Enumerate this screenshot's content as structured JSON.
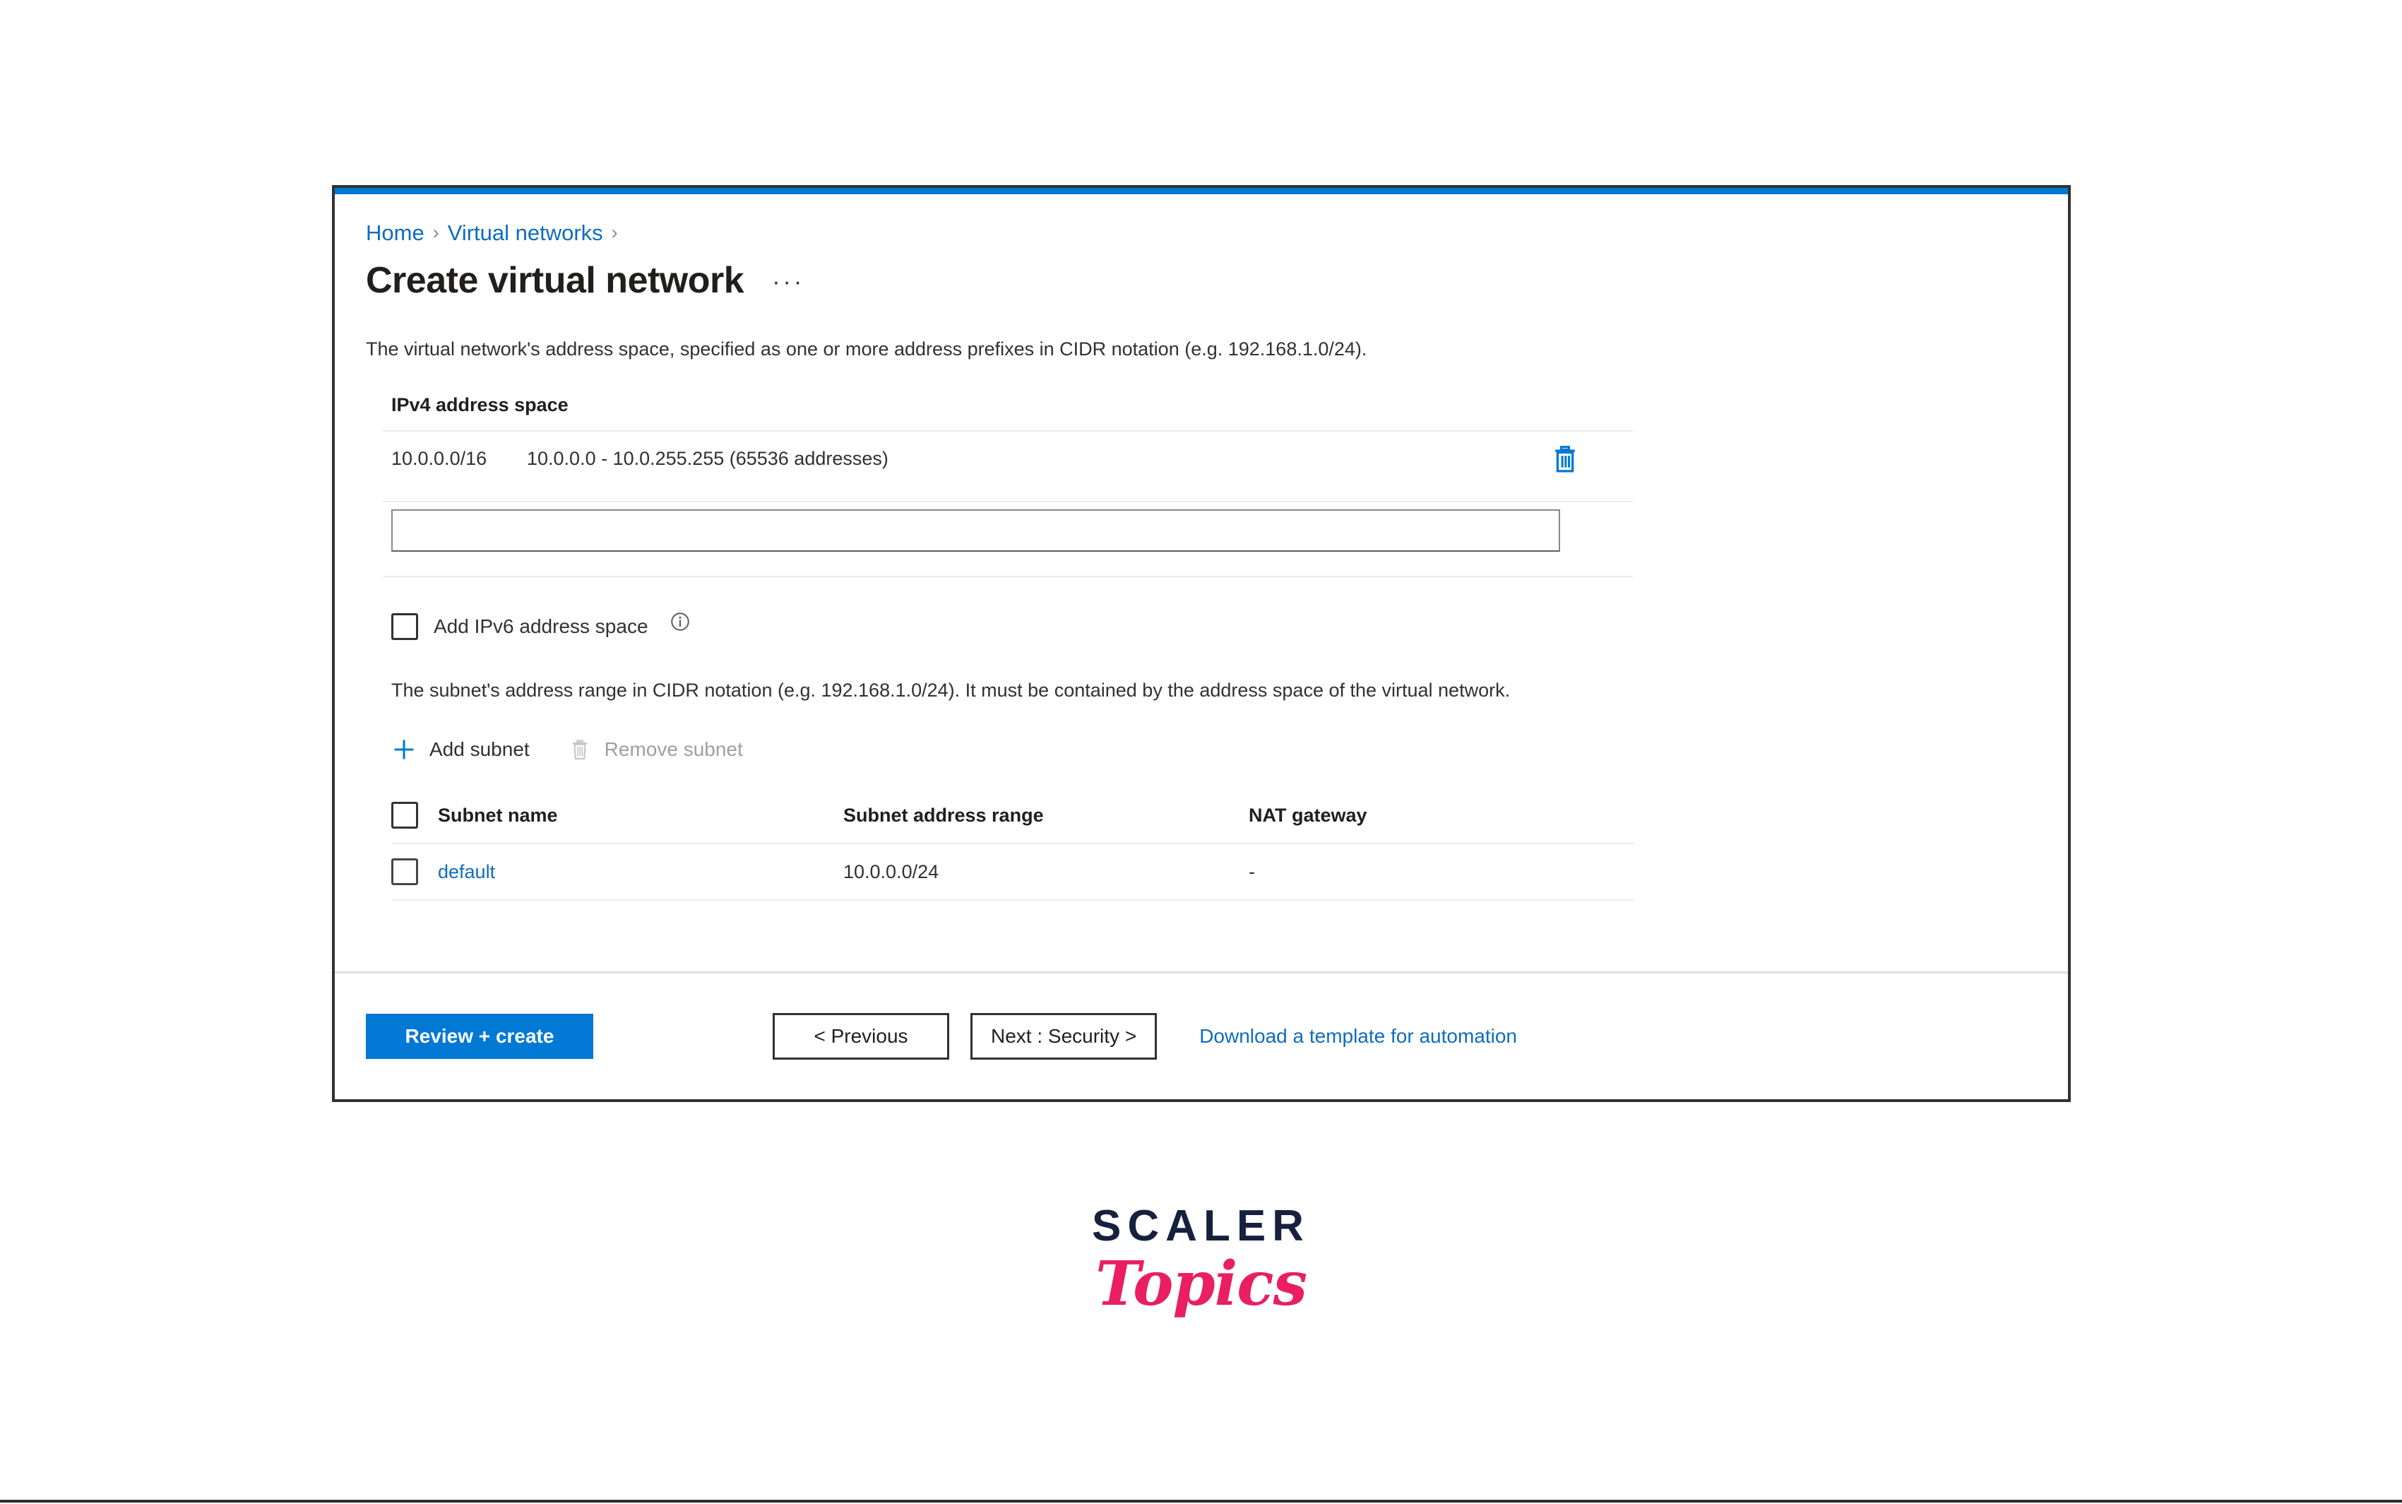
{
  "breadcrumb": {
    "items": [
      {
        "label": "Home"
      },
      {
        "label": "Virtual networks"
      }
    ],
    "separator": "›"
  },
  "header": {
    "title": "Create virtual network",
    "more_actions": "···"
  },
  "address_space": {
    "helper_text": "The virtual network's address space, specified as one or more address prefixes in CIDR notation (e.g. 192.168.1.0/24).",
    "label": "IPv4 address space",
    "rows": [
      {
        "cidr": "10.0.0.0/16",
        "range": "10.0.0.0 - 10.0.255.255 (65536 addresses)",
        "delete_icon": "trash-icon"
      }
    ],
    "new_entry": {
      "value": "",
      "placeholder": ""
    },
    "ipv6": {
      "label": "Add IPv6 address space",
      "checked": false,
      "info_icon": "info-icon"
    }
  },
  "subnets": {
    "helper_text": "The subnet's address range in CIDR notation (e.g. 192.168.1.0/24). It must be contained by the address space of the virtual network.",
    "commands": [
      {
        "label": "Add subnet",
        "icon": "plus-icon",
        "disabled": false
      },
      {
        "label": "Remove subnet",
        "icon": "trash-icon",
        "disabled": true
      }
    ],
    "columns": [
      {
        "label": "Subnet name"
      },
      {
        "label": "Subnet address range"
      },
      {
        "label": "NAT gateway"
      }
    ],
    "rows": [
      {
        "selected": false,
        "name": "default",
        "address_range": "10.0.0.0/24",
        "nat_gateway": "-"
      }
    ]
  },
  "footer": {
    "primary_button": "Review + create",
    "previous_button": "< Previous",
    "next_button": "Next : Security >",
    "download_link": "Download a template for automation"
  },
  "branding": {
    "logo_primary": "SCALER",
    "logo_secondary": "Topics"
  },
  "colors": {
    "accent": "#0078d4",
    "link": "#0f6cbd",
    "border": "#323130",
    "brand_navy": "#16213e",
    "brand_pink": "#e91e63"
  }
}
